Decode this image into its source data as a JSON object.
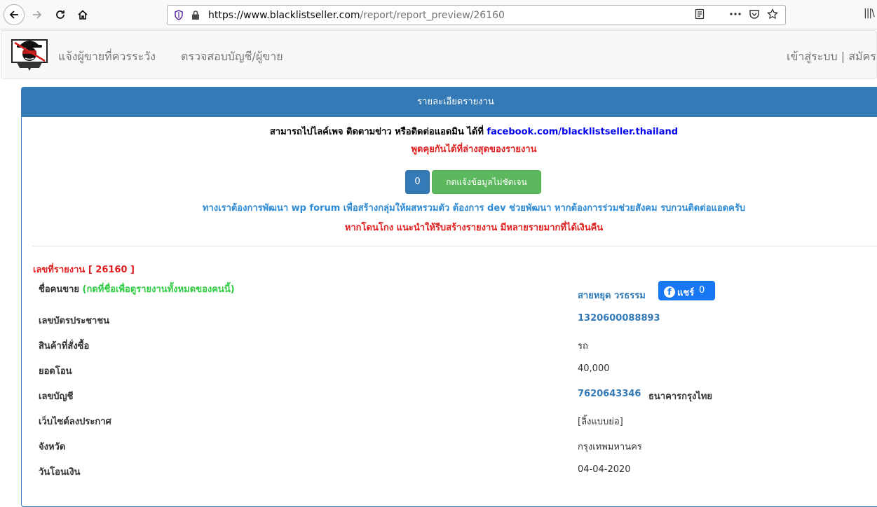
{
  "browser": {
    "url_host": "https://www.blacklistseller.com",
    "url_path": "/report/report_preview/26160",
    "icons": [
      "back-icon",
      "forward-icon",
      "reload-icon",
      "home-icon",
      "shield-icon",
      "lock-icon",
      "reader-view-icon",
      "more-icon",
      "pocket-icon",
      "bookmark-star-icon",
      "library-icon"
    ],
    "library_glyph": "|||\\"
  },
  "navbar": {
    "link_report_seller": "แจ้งผู้ขายที่ควรระวัง",
    "link_check_account": "ตรวจสอบบัญชี/ผู้ขาย",
    "link_login_register": "เข้าสู่ระบบ | สมัคร"
  },
  "panel": {
    "heading": "รายละเอียดรายงาน",
    "notice_line1_text": "สามารถไปไลค์เพจ ติดตามข่าว หรือติดต่อแอดมิน ได้ที่ ",
    "notice_line1_link": "facebook.com/blacklistseller.thailand",
    "notice_line2": "พูดคุยกันได้ที่ล่างสุดของรายงาน",
    "unclear_count": "0",
    "unclear_button": "กดแจ้งข้อมูลไม่ชัดเจน",
    "notice_line3": "ทางเราต้องการพัฒนา wp forum เพื่อสร้างกลุ่มให้ผสหรวมตัว ต้องการ dev ช่วยพัฒนา หากต้องการร่วมช่วยสังคม รบกวนติดต่อแอดครับ",
    "notice_line4": "หากโดนโกง แนะนำให้รีบสร้างรายงาน มีหลายรายมากที่ได้เงินคืน"
  },
  "report": {
    "number_label": "เลขที่รายงาน [ 26160 ]",
    "seller_label": "ชื่อคนขาย ",
    "seller_hint": "(กดที่ชื่อเพื่อดูรายงานทั้งหมดของคนนี้)",
    "seller_name": "สายหยุด วรธรรม",
    "share_label": "แชร์",
    "share_count": "0",
    "id_label": "เลขบัตรประชาชน",
    "id_value": "1320600088893",
    "product_label": "สินค้าที่สั่งซื้อ",
    "product_value": "รถ",
    "amount_label": "ยอดโอน",
    "amount_value": "40,000",
    "account_label": "เลขบัญชี",
    "account_value": "7620643346",
    "bank_value": "ธนาคารกรุงไทย",
    "website_label": "เว็บไซต์ลงประกาศ",
    "website_value": "[ลิ้งแบบย่อ]",
    "province_label": "จังหวัด",
    "province_value": "กรุงเทพมหานคร",
    "date_label": "วันโอนเงิน",
    "date_value": "04-04-2020"
  }
}
